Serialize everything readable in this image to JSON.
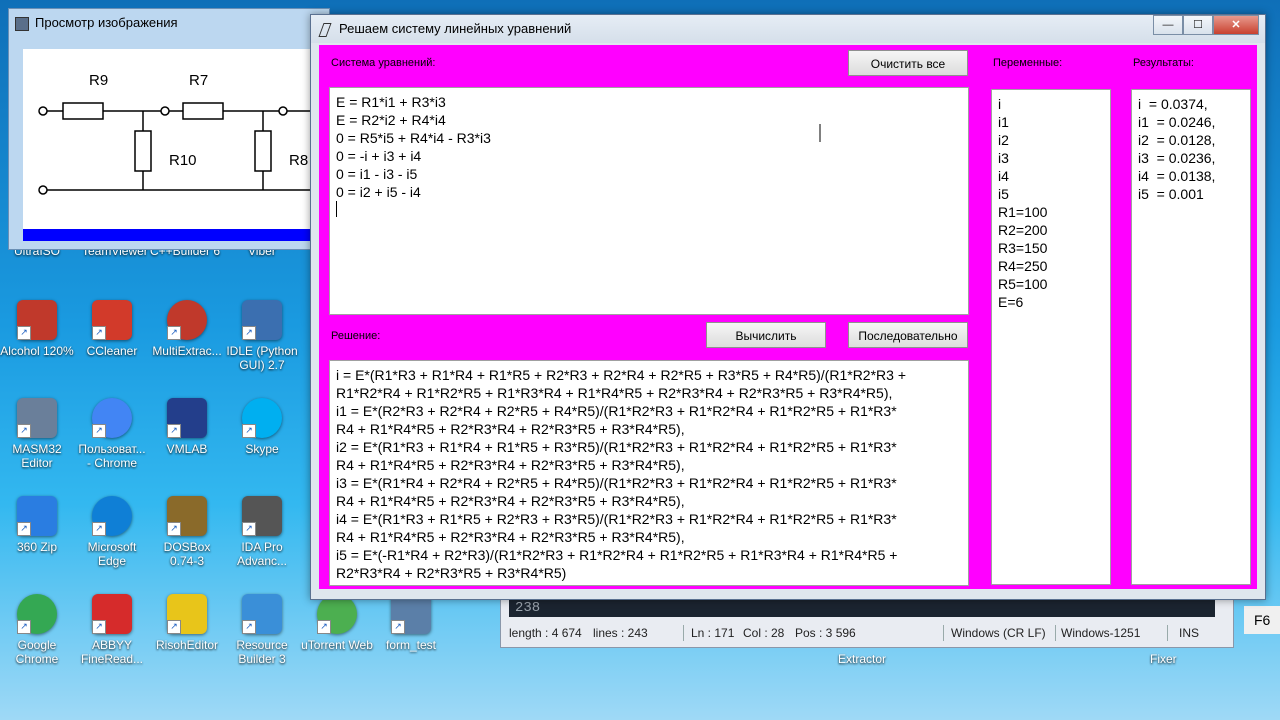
{
  "viewer": {
    "title": "Просмотр изображения",
    "labels": [
      "R9",
      "R7",
      "R10",
      "R8"
    ]
  },
  "main": {
    "title": "Решаем систему линейных уравнений",
    "window_buttons": {
      "minimize": "—",
      "maximize": "☐",
      "close": "✕"
    },
    "equations_label": "Система уравнений:",
    "clear_button": "Очистить все",
    "variables_label": "Переменные:",
    "results_label": "Результаты:",
    "solution_label": "Решение:",
    "compute_button": "Вычислить",
    "sequential_button": "Последовательно",
    "equations": [
      "E = R1*i1 + R3*i3",
      "E = R2*i2 + R4*i4",
      "0 = R5*i5 + R4*i4 - R3*i3",
      "0 = -i + i3 + i4",
      "0 = i1 - i3 - i5",
      "0 = i2 + i5 - i4"
    ],
    "variables": [
      "i",
      "i1",
      "i2",
      "i3",
      "i4",
      "i5",
      "R1=100",
      "R2=200",
      "R3=150",
      "R4=250",
      "R5=100",
      "E=6"
    ],
    "results": [
      "i  = 0.0374,",
      "i1  = 0.0246,",
      "i2  = 0.0128,",
      "i3  = 0.0236,",
      "i4  = 0.0138,",
      "i5  = 0.001"
    ],
    "solution": [
      "i = E*(R1*R3 + R1*R4 + R1*R5 + R2*R3 + R2*R4 + R2*R5 + R3*R5 + R4*R5)/(R1*R2*R3 +",
      "R1*R2*R4 + R1*R2*R5 + R1*R3*R4 + R1*R4*R5 + R2*R3*R4 + R2*R3*R5 + R3*R4*R5),",
      "i1 = E*(R2*R3 + R2*R4 + R2*R5 + R4*R5)/(R1*R2*R3 + R1*R2*R4 + R1*R2*R5 + R1*R3*",
      "R4 + R1*R4*R5 + R2*R3*R4 + R2*R3*R5 + R3*R4*R5),",
      "i2 = E*(R1*R3 + R1*R4 + R1*R5 + R3*R5)/(R1*R2*R3 + R1*R2*R4 + R1*R2*R5 + R1*R3*",
      "R4 + R1*R4*R5 + R2*R3*R4 + R2*R3*R5 + R3*R4*R5),",
      "i3 = E*(R1*R4 + R2*R4 + R2*R5 + R4*R5)/(R1*R2*R3 + R1*R2*R4 + R1*R2*R5 + R1*R3*",
      "R4 + R1*R4*R5 + R2*R3*R4 + R2*R3*R5 + R3*R4*R5),",
      "i4 = E*(R1*R3 + R1*R5 + R2*R3 + R3*R5)/(R1*R2*R3 + R1*R2*R4 + R1*R2*R5 + R1*R3*",
      "R4 + R1*R4*R5 + R2*R3*R4 + R2*R3*R5 + R3*R4*R5),",
      "i5 = E*(-R1*R4 + R2*R3)/(R1*R2*R3 + R1*R2*R4 + R1*R2*R5 + R1*R3*R4 + R1*R4*R5 +",
      "R2*R3*R4 + R2*R3*R5 + R3*R4*R5)"
    ]
  },
  "editor": {
    "line": "238",
    "status": {
      "length": "length : 4 674",
      "lines": "lines : 243",
      "ln": "Ln : 171",
      "col": "Col : 28",
      "pos": "Pos : 3 596",
      "eol": "Windows (CR LF)",
      "enc": "Windows-1251",
      "mode": "INS"
    },
    "f6": "F6"
  },
  "desktop": {
    "top_row": [
      "UltraISO",
      "TeamViewer",
      "C++Builder 6",
      "Viber"
    ],
    "icons": [
      {
        "label": "Alcohol 120%",
        "color": "#c0392b"
      },
      {
        "label": "CCleaner",
        "color": "#d23a2a"
      },
      {
        "label": "MultiExtrac...",
        "color": "#c0392b"
      },
      {
        "label": "IDLE (Python GUI) 2.7",
        "color": "#3b6fb0"
      },
      {
        "label": "MASM32 Editor",
        "color": "#6a7f9a"
      },
      {
        "label": "Пользоват... - Chrome",
        "color": "#4285f4"
      },
      {
        "label": "VMLAB",
        "color": "#233e8b"
      },
      {
        "label": "Skype",
        "color": "#00aff0"
      },
      {
        "label": "360 Zip",
        "color": "#2a7de1"
      },
      {
        "label": "Microsoft Edge",
        "color": "#0f7fd6"
      },
      {
        "label": "DOSBox 0.74-3",
        "color": "#8a6a2a"
      },
      {
        "label": "IDA Pro Advanc...",
        "color": "#555555"
      },
      {
        "label": "Google Chrome",
        "color": "#34a853"
      },
      {
        "label": "ABBYY FineRead...",
        "color": "#d62b2b"
      },
      {
        "label": "RisohEditor",
        "color": "#e8c51a"
      },
      {
        "label": "Resource Builder 3",
        "color": "#3a8fd8"
      },
      {
        "label": "uTorrent Web",
        "color": "#4caf50"
      },
      {
        "label": "form_test",
        "color": "#5b7fa8"
      }
    ],
    "taskbar_labels": [
      "Extractor",
      "Fixer"
    ]
  }
}
